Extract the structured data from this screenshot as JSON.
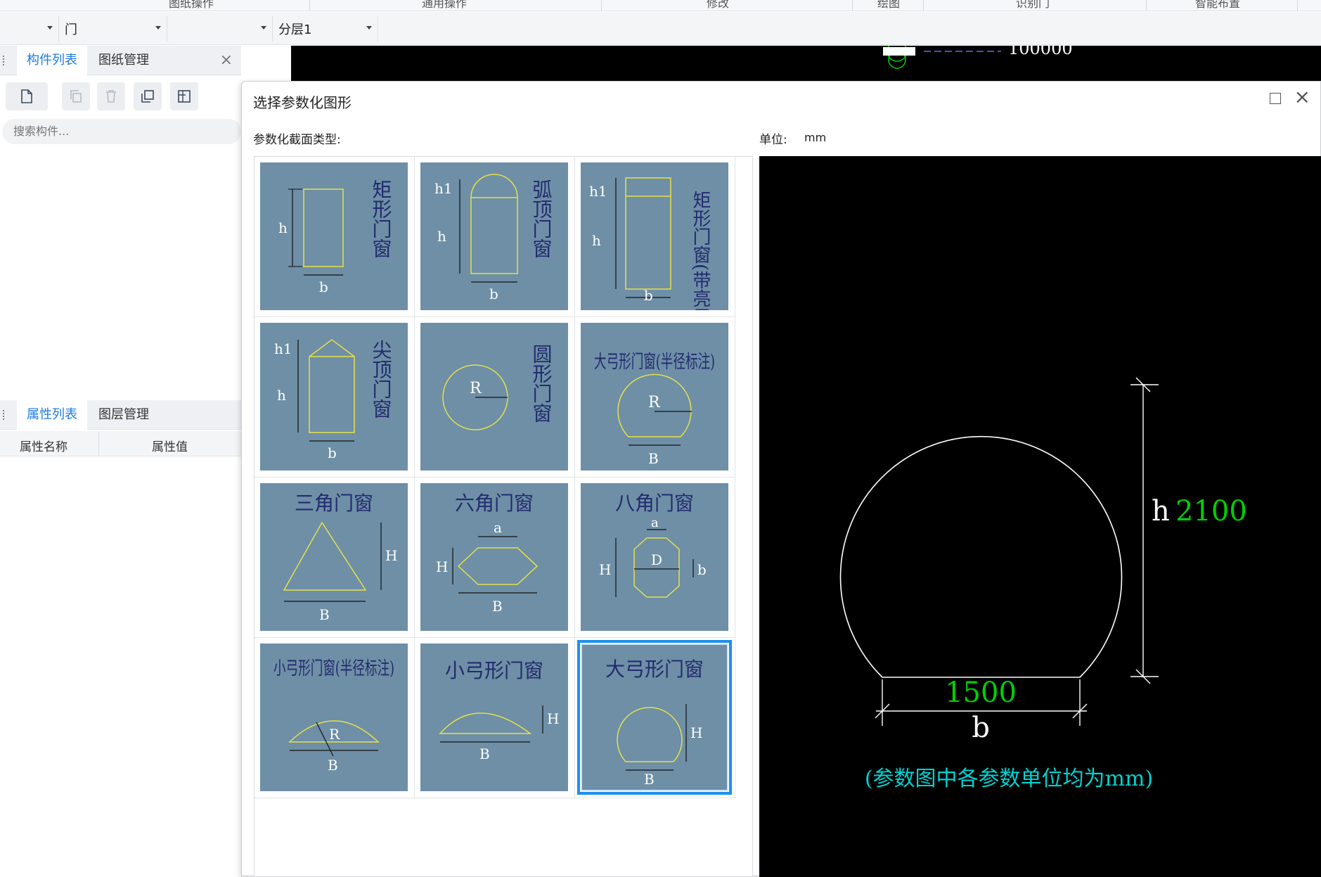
{
  "ribbon": {
    "labels": [
      "图纸操作",
      "通用操作",
      "修改",
      "绘图",
      "识别门",
      "智能布置"
    ]
  },
  "toolbar": {
    "combo1": "",
    "combo2": "门",
    "combo3": "",
    "combo4": "分层1"
  },
  "left_panel": {
    "tabs": [
      "构件列表",
      "图纸管理"
    ],
    "search_placeholder": "搜索构件...",
    "prop_tabs": [
      "属性列表",
      "图层管理"
    ],
    "prop_columns": [
      "属性名称",
      "属性值"
    ]
  },
  "cad_strip": {
    "text": "100000"
  },
  "dialog": {
    "title": "选择参数化图形",
    "section_label": "参数化截面类型:",
    "unit_label": "单位:",
    "unit_value": "mm",
    "shapes": [
      {
        "name": "矩形门窗",
        "labels": [
          "h",
          "b"
        ]
      },
      {
        "name": "弧顶门窗",
        "labels": [
          "h1",
          "h",
          "b"
        ]
      },
      {
        "name": "矩形门窗(带亮子)",
        "labels": [
          "h1",
          "h",
          "b"
        ]
      },
      {
        "name": "尖顶门窗",
        "labels": [
          "h1",
          "h",
          "b"
        ]
      },
      {
        "name": "圆形门窗",
        "labels": [
          "R"
        ]
      },
      {
        "name": "大弓形门窗(半径标注)",
        "labels": [
          "R",
          "B"
        ]
      },
      {
        "name": "三角门窗",
        "labels": [
          "H",
          "B"
        ]
      },
      {
        "name": "六角门窗",
        "labels": [
          "a",
          "H",
          "B"
        ]
      },
      {
        "name": "八角门窗",
        "labels": [
          "a",
          "H",
          "D",
          "b"
        ]
      },
      {
        "name": "小弓形门窗(半径标注)",
        "labels": [
          "R",
          "B"
        ]
      },
      {
        "name": "小弓形门窗",
        "labels": [
          "H",
          "B"
        ]
      },
      {
        "name": "大弓形门窗",
        "labels": [
          "H",
          "B"
        ]
      }
    ],
    "selected_index": 11
  },
  "preview": {
    "h_label": "h",
    "h_value": "2100",
    "b_label": "b",
    "b_value": "1500",
    "note": "(参数图中各参数单位均为mm)",
    "value_color": "#00d000",
    "note_color": "#00d2d2",
    "line_color": "#ffffff"
  }
}
